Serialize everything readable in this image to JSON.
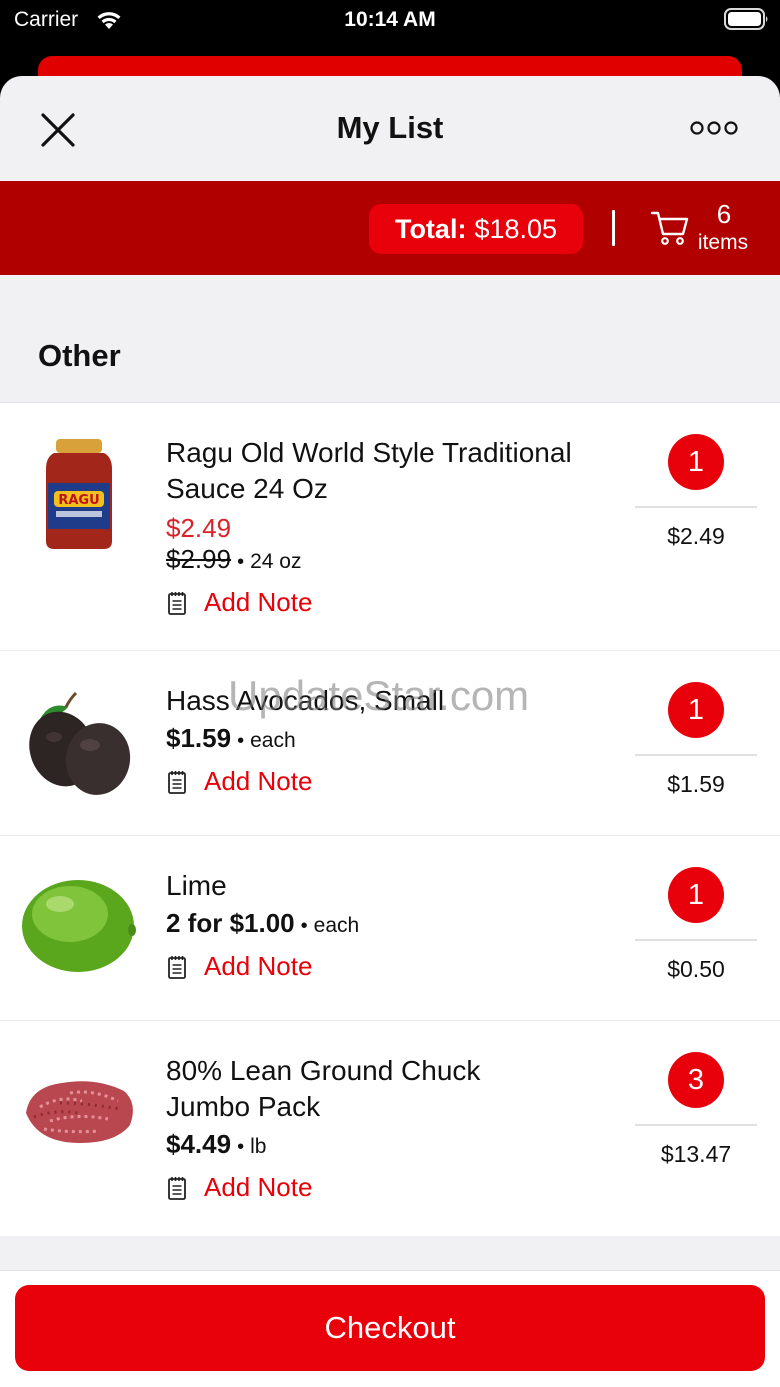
{
  "status_bar": {
    "carrier": "Carrier",
    "time": "10:14 AM"
  },
  "nav": {
    "title": "My List",
    "close_icon": "close-icon",
    "more_icon": "more-icon"
  },
  "summary": {
    "total_label": "Total:",
    "total_value": "$18.05",
    "item_count": "6",
    "items_label": "items"
  },
  "section": {
    "title": "Other"
  },
  "items": [
    {
      "name_line1": "Ragu Old World Style Traditional",
      "name_line2": "Sauce 24 Oz",
      "sale_price": "$2.49",
      "regular_price": "$2.99",
      "unit": "24 oz",
      "note_label": "Add Note",
      "quantity": "1",
      "line_total": "$2.49"
    },
    {
      "name_line1": "Hass Avocados, Small",
      "price": "$1.59",
      "unit": "each",
      "note_label": "Add Note",
      "quantity": "1",
      "line_total": "$1.59"
    },
    {
      "name_line1": "Lime",
      "price": "2 for $1.00",
      "unit": "each",
      "note_label": "Add Note",
      "quantity": "1",
      "line_total": "$0.50"
    },
    {
      "name_line1": "80% Lean Ground Chuck",
      "name_line2": "Jumbo Pack",
      "price": "$4.49",
      "unit": "lb",
      "note_label": "Add Note",
      "quantity": "3",
      "line_total": "$13.47"
    }
  ],
  "watermark": "UpdateStar.com",
  "checkout": {
    "label": "Checkout"
  },
  "colors": {
    "accent": "#e8000a",
    "total_bar": "#b00000",
    "sale_price": "#d8232a",
    "background": "#f1f1f3"
  }
}
